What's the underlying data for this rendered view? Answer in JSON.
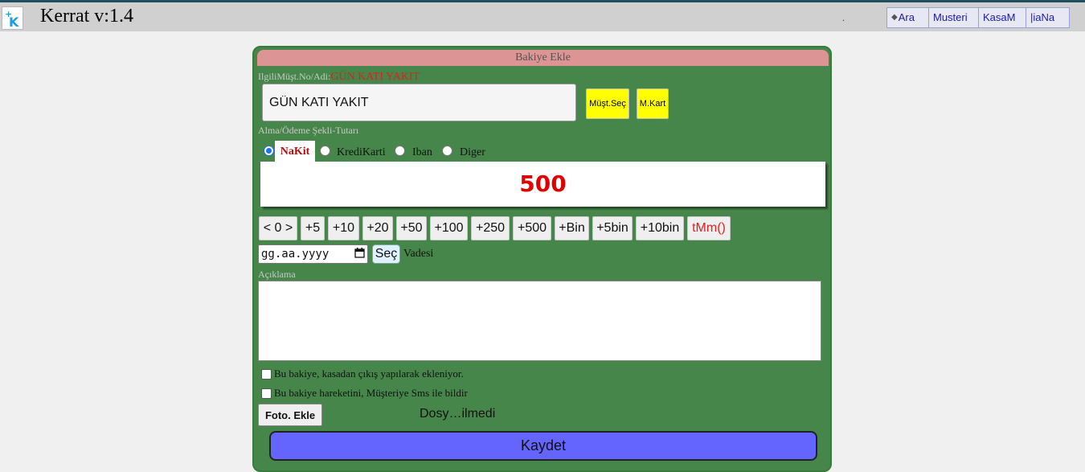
{
  "header": {
    "app_title": "Kerrat v:1.4",
    "separator": ".",
    "nav": [
      {
        "label": "Ara",
        "icon": "diamond-icon"
      },
      {
        "label": "Musteri"
      },
      {
        "label": "KasaM"
      },
      {
        "label": "|iaNa"
      }
    ]
  },
  "form": {
    "title": "Bakiye Ekle",
    "customer_label": "IlgiliMüşt.No/Adi:",
    "customer_name_inline": "GÜN KATI YAKIT",
    "customer_input_value": "GÜN KATI YAKIT",
    "select_customer_button": "Müşt.Seç",
    "m_card_button": "M.Kart",
    "payment_label": "Alma/Ödeme Şekli-Tutarı",
    "payment_methods": [
      {
        "label": "NaKit",
        "checked": true
      },
      {
        "label": "KrediKarti",
        "checked": false
      },
      {
        "label": "Iban",
        "checked": false
      },
      {
        "label": "Diger",
        "checked": false
      }
    ],
    "amount": "500",
    "quick_buttons": [
      "< 0 >",
      "+5",
      "+10",
      "+20",
      "+50",
      "+100",
      "+250",
      "+500",
      "+Bin",
      "+5bin",
      "+10bin",
      "tMm()"
    ],
    "date_placeholder": "gg.aa.yyyy",
    "date_select_button": "Seç",
    "due_label": "Vadesi",
    "description_label": "Açıklama",
    "description_value": "",
    "checkbox_kasa": "Bu bakiye, kasadan çıkış yapılarak ekleniyor.",
    "checkbox_sms": "Bu bakiye hareketini, Müşteriye Sms ile bildir",
    "photo_button": "Foto. Ekle",
    "file_status": "Dosy…ilmedi",
    "save_button": "Kaydet"
  },
  "colors": {
    "panel_bg": "#46864a",
    "title_bar": "#dc9494",
    "amount_text": "#e00000",
    "save_button": "#6464ff",
    "action_buttons": "#ffff00"
  }
}
